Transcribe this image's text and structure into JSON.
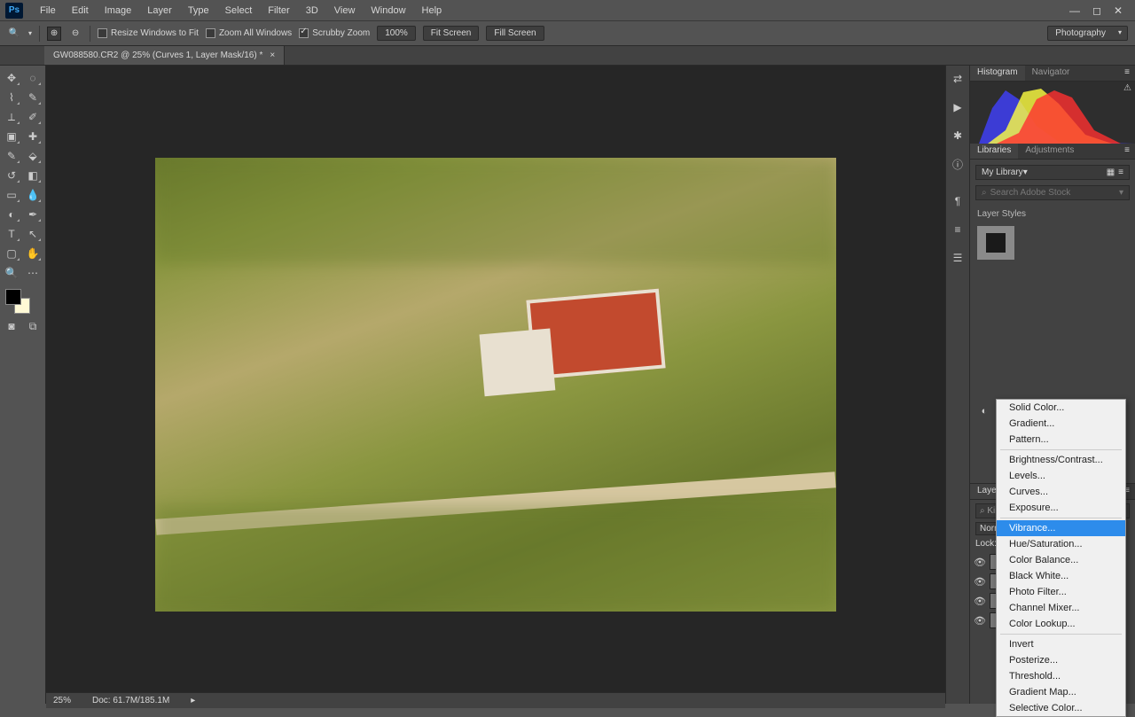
{
  "menubar": [
    "File",
    "Edit",
    "Image",
    "Layer",
    "Type",
    "Select",
    "Filter",
    "3D",
    "View",
    "Window",
    "Help"
  ],
  "optbar": {
    "resize": "Resize Windows to Fit",
    "zoomall": "Zoom All Windows",
    "scrubby": "Scrubby Zoom",
    "zoom": "100%",
    "fit": "Fit Screen",
    "fill": "Fill Screen"
  },
  "workspace": "Photography",
  "doc_tab": "GW088580.CR2 @ 25% (Curves 1, Layer Mask/16) *",
  "right": {
    "tabs1": [
      "Histogram",
      "Navigator"
    ],
    "tabs2": [
      "Libraries",
      "Adjustments"
    ],
    "library_sel": "My Library",
    "search_ph": "Search Adobe Stock",
    "section": "Layer Styles",
    "layers_tab": "Layers",
    "search2": "Kin",
    "blend_mode": "Norm",
    "lock_label": "Lock:"
  },
  "ctxmenu": {
    "items_a": [
      "Solid Color...",
      "Gradient...",
      "Pattern..."
    ],
    "items_b": [
      "Brightness/Contrast...",
      "Levels...",
      "Curves...",
      "Exposure..."
    ],
    "items_c": [
      "Vibrance...",
      "Hue/Saturation...",
      "Color Balance...",
      "Black  White...",
      "Photo Filter...",
      "Channel Mixer...",
      "Color Lookup..."
    ],
    "items_d": [
      "Invert",
      "Posterize...",
      "Threshold...",
      "Gradient Map...",
      "Selective Color..."
    ],
    "highlight": "Vibrance..."
  },
  "status": {
    "zoom": "25%",
    "doc": "Doc: 61.7M/185.1M"
  }
}
